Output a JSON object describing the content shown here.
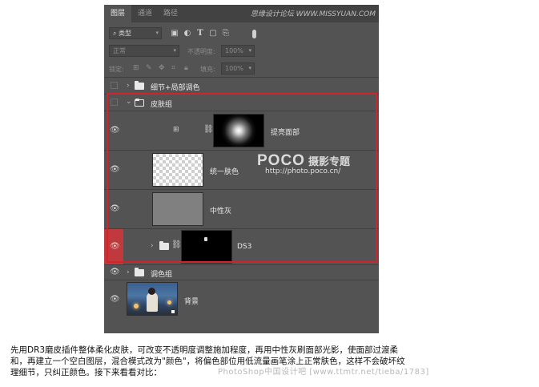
{
  "tabs": [
    {
      "label": "图层",
      "active": true
    },
    {
      "label": "通道",
      "active": false
    },
    {
      "label": "路径",
      "active": false
    }
  ],
  "watermark_top": "思缘设计论坛 WWW.MISSYUAN.COM",
  "filter": {
    "label": "类型"
  },
  "blend_mode": "正常",
  "opacity": {
    "label": "不透明度:",
    "value": "100%"
  },
  "lock": {
    "label": "锁定:"
  },
  "fill": {
    "label": "填充:",
    "value": "100%"
  },
  "layers": [
    {
      "name": "细节+局部调色",
      "kind": "group",
      "visible": false
    },
    {
      "name": "皮肤组",
      "kind": "group-open",
      "visible": false
    },
    {
      "name": "提亮面部",
      "kind": "adjustment-mask",
      "visible": true
    },
    {
      "name": "统一肤色",
      "kind": "pixel-transparent",
      "visible": true
    },
    {
      "name": "中性灰",
      "kind": "pixel-gray",
      "visible": true
    },
    {
      "name": "DS3",
      "kind": "group-mask",
      "visible": true,
      "selected": true
    },
    {
      "name": "调色组",
      "kind": "group",
      "visible": true
    },
    {
      "name": "背景",
      "kind": "photo",
      "visible": true
    }
  ],
  "poco": {
    "brand": "POCO",
    "title": "摄影专题",
    "url": "http://photo.poco.cn/"
  },
  "caption": [
    "先用DR3磨皮插件整体柔化皮肤，可改变不透明度调整施加程度，再用中性灰刷面部光影，使面部过渡柔",
    "和，再建立一个空白图层，混合模式改为\"颜色\"，将偏色部位用低流量画笔涂上正常肤色，这样不会破坏纹",
    "理细节，只纠正颜色。接下来看看对比："
  ],
  "watermark_bottom": "PhotoShop中国设计吧 [www.ttmtr.net/tieba/1783]",
  "colors": {
    "highlight": "#d2232a",
    "selected_eye_bg": "#c0393c",
    "panel": "#535353"
  }
}
